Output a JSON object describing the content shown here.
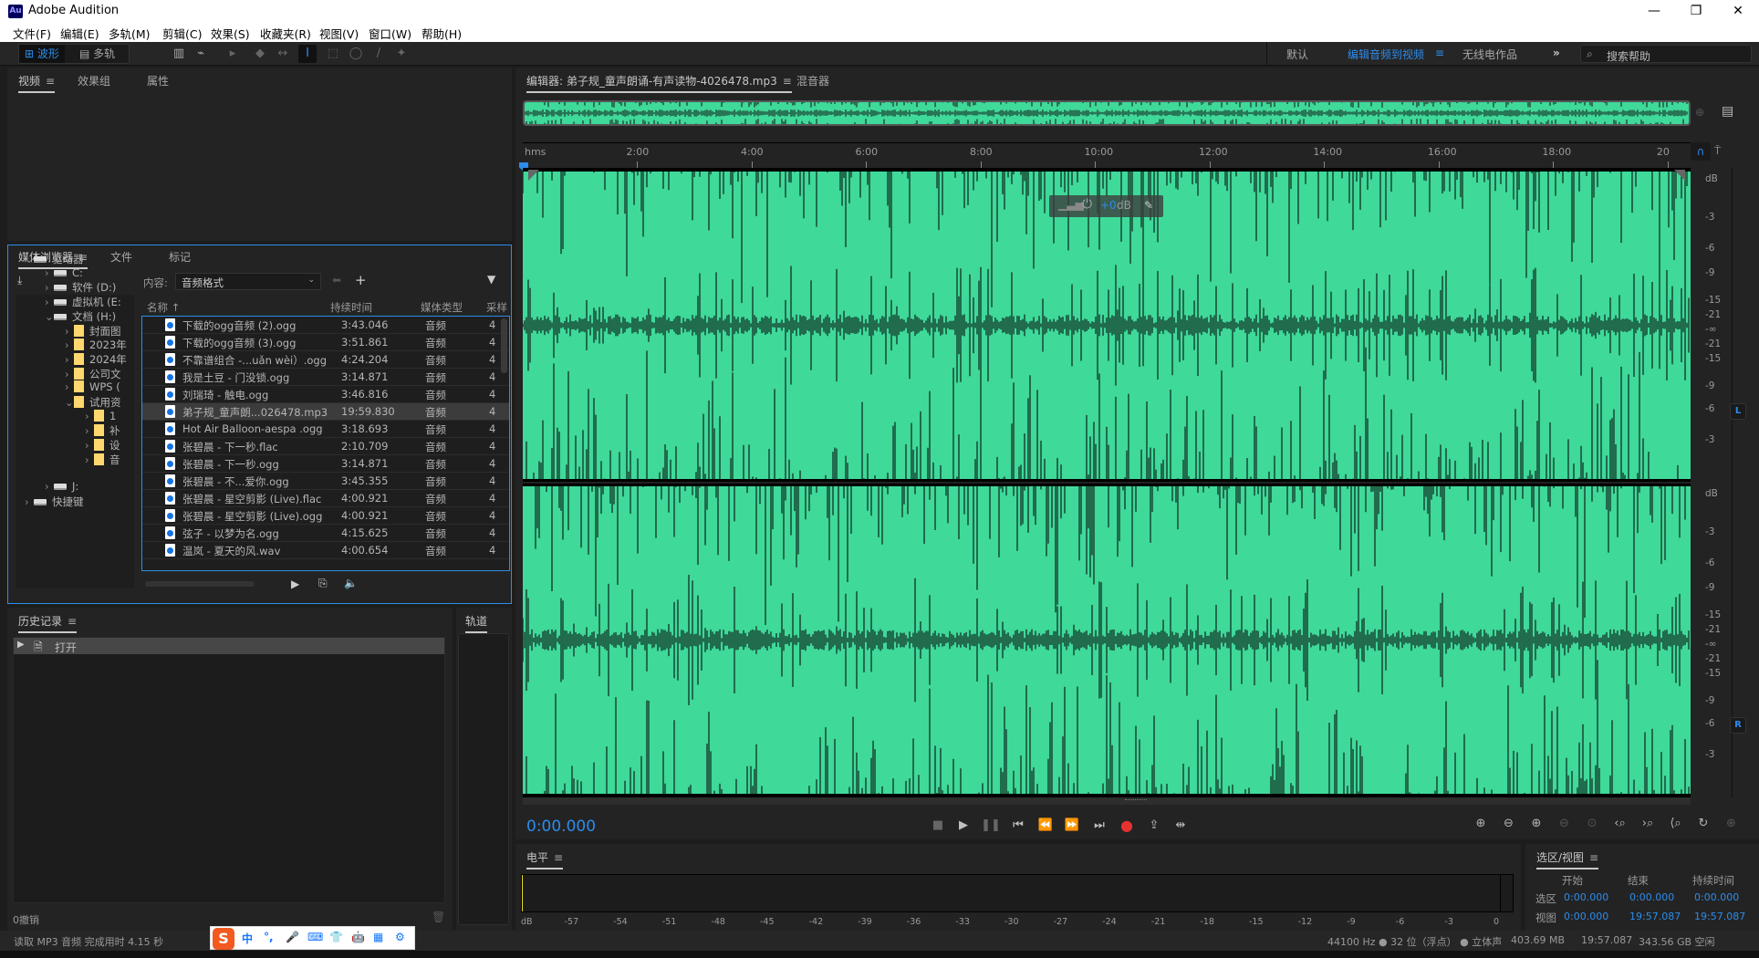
{
  "app": {
    "title": "Adobe Audition",
    "logo": "Au"
  },
  "window_controls": {
    "minimize": "—",
    "maximize": "❐",
    "close": "✕"
  },
  "menu": [
    "文件(F)",
    "编辑(E)",
    "多轨(M)",
    "剪辑(C)",
    "效果(S)",
    "收藏夹(R)",
    "视图(V)",
    "窗口(W)",
    "帮助(H)"
  ],
  "toolbar": {
    "waveform_label": "波形",
    "multitrack_label": "多轨",
    "workspaces": [
      "默认",
      "编辑音频到视频",
      "无线电作品"
    ],
    "active_workspace": "编辑音频到视频",
    "more": "»",
    "search_placeholder": "搜索帮助"
  },
  "top_left_panel": {
    "tabs": [
      "视频",
      "效果组",
      "属性"
    ],
    "active": "视频"
  },
  "media_browser": {
    "tabs": [
      "媒体浏览器",
      "文件",
      "标记"
    ],
    "content_label": "内容:",
    "content_value": "音频格式",
    "tree": [
      {
        "label": "驱动器",
        "level": 0,
        "expanded": true,
        "type": "root"
      },
      {
        "label": "C:",
        "level": 1,
        "type": "drive"
      },
      {
        "label": "软件 (D:)",
        "level": 1,
        "type": "drive"
      },
      {
        "label": "虚拟机 (E:",
        "level": 1,
        "type": "drive"
      },
      {
        "label": "文档 (H:)",
        "level": 1,
        "expanded": true,
        "type": "drive"
      },
      {
        "label": "封面图",
        "level": 2,
        "type": "folder"
      },
      {
        "label": "2023年",
        "level": 2,
        "type": "folder"
      },
      {
        "label": "2024年",
        "level": 2,
        "type": "folder"
      },
      {
        "label": "公司文",
        "level": 2,
        "type": "folder"
      },
      {
        "label": "WPS (",
        "level": 2,
        "type": "folder"
      },
      {
        "label": "试用资",
        "level": 2,
        "expanded": true,
        "type": "folder"
      },
      {
        "label": "1",
        "level": 3,
        "type": "folder"
      },
      {
        "label": "补",
        "level": 3,
        "type": "folder"
      },
      {
        "label": "设",
        "level": 3,
        "type": "folder"
      },
      {
        "label": "音",
        "level": 3,
        "type": "folder"
      },
      {
        "label": "J:",
        "level": 1,
        "type": "drive"
      },
      {
        "label": "快捷键",
        "level": 0,
        "type": "root"
      }
    ],
    "columns": [
      "名称 ↑",
      "持续时间",
      "媒体类型",
      "采样"
    ],
    "files": [
      {
        "name": "下载的ogg音频 (2).ogg",
        "duration": "3:43.046",
        "type": "音频",
        "rate": "4"
      },
      {
        "name": "下载的ogg音频 (3).ogg",
        "duration": "3:51.861",
        "type": "音频",
        "rate": "4"
      },
      {
        "name": "不靠谱组合 -...uǎn wèi）.ogg",
        "duration": "4:24.204",
        "type": "音频",
        "rate": "4"
      },
      {
        "name": "我是土豆 - 门没锁.ogg",
        "duration": "3:14.871",
        "type": "音频",
        "rate": "4"
      },
      {
        "name": "刘瑞琦 - 触电.ogg",
        "duration": "3:46.816",
        "type": "音频",
        "rate": "4"
      },
      {
        "name": "弟子规_童声朗...026478.mp3",
        "duration": "19:59.830",
        "type": "音频",
        "rate": "4",
        "selected": true
      },
      {
        "name": " Hot Air Balloon-aespa .ogg",
        "duration": "3:18.693",
        "type": "音频",
        "rate": "4"
      },
      {
        "name": "张碧晨 - 下一秒.flac",
        "duration": "2:10.709",
        "type": "音频",
        "rate": "4"
      },
      {
        "name": "张碧晨 - 下一秒.ogg",
        "duration": "3:14.871",
        "type": "音频",
        "rate": "4"
      },
      {
        "name": "张碧晨 - 不...爱你.ogg",
        "duration": "3:45.355",
        "type": "音频",
        "rate": "4"
      },
      {
        "name": "张碧晨 - 星空剪影 (Live).flac",
        "duration": "4:00.921",
        "type": "音频",
        "rate": "4"
      },
      {
        "name": "张碧晨 - 星空剪影 (Live).ogg",
        "duration": "4:00.921",
        "type": "音频",
        "rate": "4"
      },
      {
        "name": "弦子 - 以梦为名.ogg",
        "duration": "4:15.625",
        "type": "音频",
        "rate": "4"
      },
      {
        "name": "温岚 - 夏天的风.wav",
        "duration": "4:00.654",
        "type": "音频",
        "rate": "4"
      }
    ]
  },
  "history": {
    "title": "历史记录",
    "items": [
      "打开"
    ],
    "undo_count": "0撤销"
  },
  "tracks": {
    "title": "轨道"
  },
  "editor": {
    "tab_label": "编辑器: 弟子规_童声朗诵-有声读物-4026478.mp3",
    "mixer_label": "混音器",
    "ruler_unit": "hms",
    "ruler_ticks": [
      "2:00",
      "4:00",
      "6:00",
      "8:00",
      "10:00",
      "12:00",
      "14:00",
      "16:00",
      "18:00",
      "20"
    ],
    "hud_gain": "+0",
    "hud_unit": "dB",
    "db_scale_top": [
      "dB",
      "-3",
      "-6",
      "-9",
      "-15",
      "-21",
      "-∞",
      "-21",
      "-15",
      "-9",
      "-6",
      "-3"
    ],
    "db_scale_bottom": [
      "dB",
      "-3",
      "-6",
      "-9",
      "-15",
      "-21",
      "-∞",
      "-21",
      "-15",
      "-9",
      "-6",
      "-3"
    ],
    "channel_left": "L",
    "channel_right": "R",
    "waveform_color": "#3fd99a",
    "current_time": "0:00.000"
  },
  "transport": [
    "stop",
    "play",
    "pause",
    "go-to-start",
    "rewind",
    "fast-forward",
    "go-to-end",
    "record",
    "loop",
    "skip-selection"
  ],
  "levels": {
    "title": "电平",
    "scale": [
      "dB",
      "-57",
      "-54",
      "-51",
      "-48",
      "-45",
      "-42",
      "-39",
      "-36",
      "-33",
      "-30",
      "-27",
      "-24",
      "-21",
      "-18",
      "-15",
      "-12",
      "-9",
      "-6",
      "-3",
      "0"
    ]
  },
  "selection_view": {
    "title": "选区/视图",
    "headers": [
      "开始",
      "结束",
      "持续时间"
    ],
    "rows": [
      {
        "label": "选区",
        "start": "0:00.000",
        "end": "0:00.000",
        "duration": "0:00.000"
      },
      {
        "label": "视图",
        "start": "0:00.000",
        "end": "19:57.087",
        "duration": "19:57.087"
      }
    ]
  },
  "status": {
    "message": "读取 MP3 音频 完成用时 4.15 秒",
    "sample_rate": "44100 Hz ● 32 位（浮点） ● 立体声",
    "size": "403.69 MB",
    "duration": "19:57.087",
    "free": "343.56 GB 空闲"
  },
  "ime": {
    "logo": "S",
    "items": [
      "中",
      "°,",
      "🎤",
      "⌨",
      "👕",
      "🤖",
      "▦",
      "⚙"
    ]
  }
}
